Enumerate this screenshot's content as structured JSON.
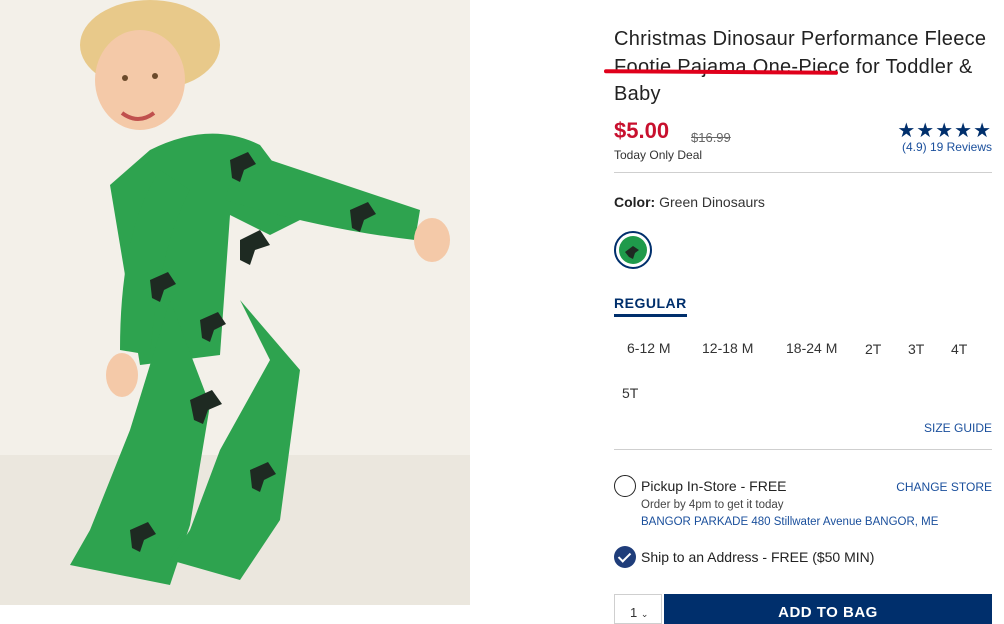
{
  "product": {
    "title": "Christmas Dinosaur Performance Fleece Footie Pajama One-Piece for Toddler & Baby",
    "price": "$5.00",
    "original_price": "$16.99",
    "deal_label": "Today Only Deal",
    "rating_stars": "★★★★★",
    "rating_value": 4.9,
    "reviews_text": "(4.9) 19 Reviews"
  },
  "color": {
    "label": "Color:",
    "value": "Green Dinosaurs"
  },
  "sizes": {
    "tab_label": "REGULAR",
    "options": [
      "6-12 M",
      "12-18 M",
      "18-24 M",
      "2T",
      "3T",
      "4T",
      "5T"
    ],
    "size_guide": "SIZE GUIDE"
  },
  "fulfillment": {
    "pickup_label": "Pickup In-Store - FREE",
    "pickup_note": "Order by 4pm to get it today",
    "store_address": "BANGOR PARKADE 480 Stillwater Avenue  BANGOR, ME",
    "change_store": "CHANGE STORE",
    "ship_label": "Ship to an Address - FREE ($50 MIN)"
  },
  "cart": {
    "quantity": "1",
    "add_to_bag": "ADD TO BAG"
  },
  "colors": {
    "accent": "#002f6c",
    "sale": "#c8102e",
    "link": "#1a4f9c",
    "annotation": "#e0001b"
  }
}
